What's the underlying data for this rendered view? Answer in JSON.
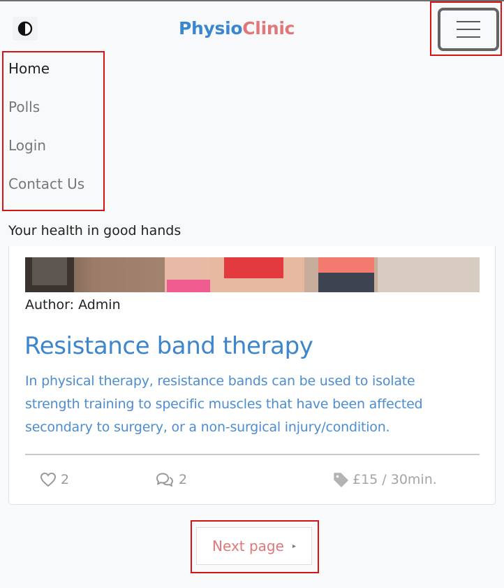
{
  "header": {
    "brand_part1": "Physio",
    "brand_part2": "Clinic",
    "colors": {
      "brand_blue": "#3a87d0",
      "brand_pink": "#e0787a"
    }
  },
  "nav": {
    "items": [
      {
        "label": "Home",
        "active": true
      },
      {
        "label": "Polls"
      },
      {
        "label": "Login"
      },
      {
        "label": "Contact Us"
      }
    ]
  },
  "tagline": "Your health in good hands",
  "post": {
    "author": "Author: Admin",
    "title": "Resistance band therapy",
    "excerpt": "In physical therapy, resistance bands can be used to isolate strength training to specific muscles that have been affected secondary to surgery, or a non-surgical injury/condition.",
    "likes": "2",
    "comments": "2",
    "price": "£15 / 30min."
  },
  "pagination": {
    "next_label": "Next page",
    "arrow": "▸"
  },
  "icons": {
    "theme": "contrast-icon",
    "menu": "hamburger-menu-icon",
    "likes": "heart-icon",
    "comments": "comments-icon",
    "price": "tag-icon"
  }
}
